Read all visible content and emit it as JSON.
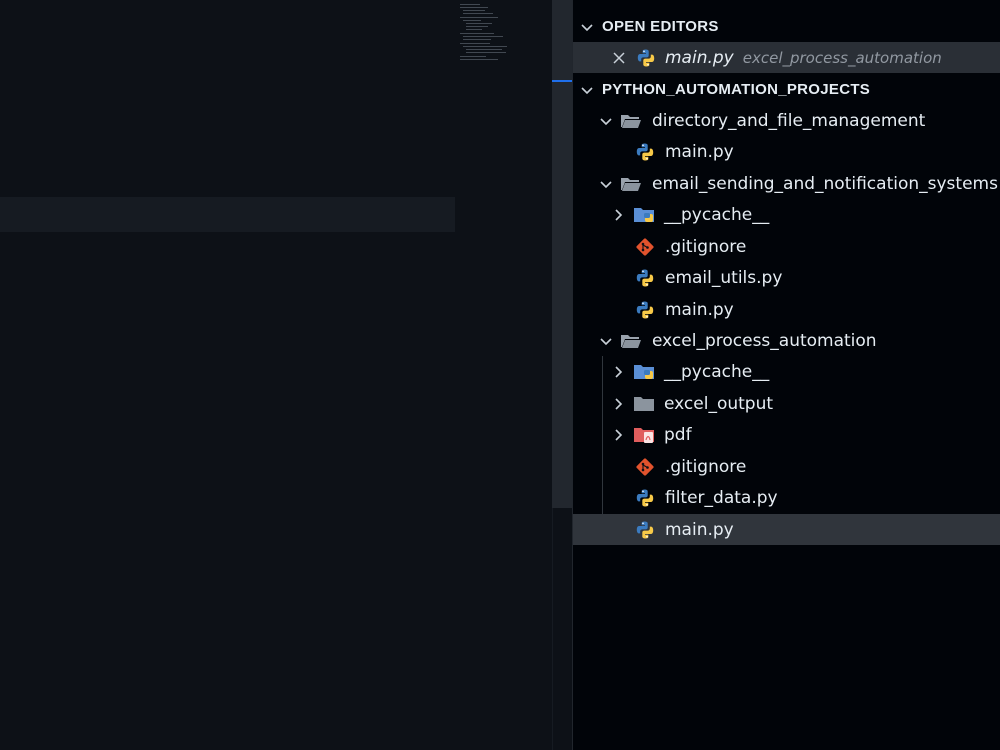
{
  "open_editors": {
    "title": "OPEN EDITORS",
    "items": [
      {
        "filename": "main.py",
        "folder": "excel_process_automation"
      }
    ]
  },
  "explorer": {
    "title": "PYTHON_AUTOMATION_PROJECTS",
    "tree": [
      {
        "label": "directory_and_file_management",
        "kind": "folder-open"
      },
      {
        "label": "main.py",
        "kind": "python"
      },
      {
        "label": "email_sending_and_notification_systems",
        "kind": "folder-open"
      },
      {
        "label": "__pycache__",
        "kind": "pycache-folder"
      },
      {
        "label": ".gitignore",
        "kind": "git"
      },
      {
        "label": "email_utils.py",
        "kind": "python"
      },
      {
        "label": "main.py",
        "kind": "python"
      },
      {
        "label": "excel_process_automation",
        "kind": "folder-open"
      },
      {
        "label": "__pycache__",
        "kind": "pycache-folder"
      },
      {
        "label": "excel_output",
        "kind": "folder"
      },
      {
        "label": "pdf",
        "kind": "pdf-folder"
      },
      {
        "label": ".gitignore",
        "kind": "git"
      },
      {
        "label": "filter_data.py",
        "kind": "python"
      },
      {
        "label": "main.py",
        "kind": "python",
        "selected": true
      }
    ]
  },
  "colors": {
    "editor_bg": "#0d1117",
    "sidebar_bg": "#010409",
    "python_blue": "#3b7bbf",
    "python_yellow": "#f7c948",
    "git_orange": "#e2532d",
    "pdf_red": "#e05d5d",
    "pycache_blue": "#5a8fd6",
    "folder_gray": "#8b949e"
  }
}
